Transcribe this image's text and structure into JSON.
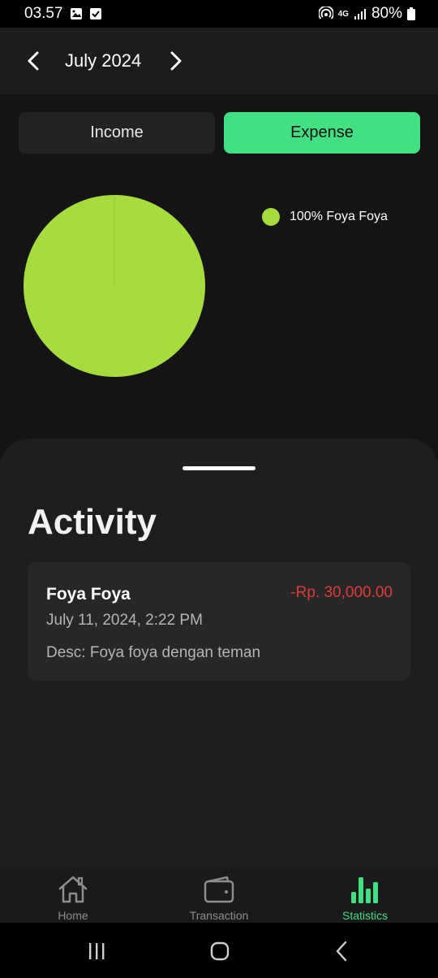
{
  "status_bar": {
    "time": "03.57",
    "network": "4G",
    "battery": "80%",
    "icons": [
      "gallery-icon",
      "checkbox-icon",
      "hotspot-icon",
      "signal-icon",
      "battery-icon"
    ]
  },
  "header": {
    "month": "July 2024",
    "prev_icon": "chevron-left-icon",
    "next_icon": "chevron-right-icon"
  },
  "toggle": {
    "income_label": "Income",
    "expense_label": "Expense",
    "selected": "Expense"
  },
  "chart_data": {
    "type": "pie",
    "slices": [
      {
        "label": "Foya Foya",
        "percent": 100,
        "color": "#a7dc3f"
      }
    ],
    "legend": [
      "100% Foya Foya"
    ],
    "legend_position": "right"
  },
  "activity": {
    "title": "Activity",
    "items": [
      {
        "name": "Foya Foya",
        "amount": "-Rp. 30,000.00",
        "date": "July 11, 2024, 2:22 PM",
        "desc": "Desc: Foya foya dengan teman"
      }
    ]
  },
  "bottom_nav": {
    "items": [
      {
        "label": "Home",
        "icon": "home-icon",
        "active": false
      },
      {
        "label": "Transaction",
        "icon": "wallet-icon",
        "active": false
      },
      {
        "label": "Statistics",
        "icon": "bar-chart-icon",
        "active": true
      }
    ]
  },
  "colors": {
    "accent": "#43df83",
    "expense_red": "#e23a3a",
    "pie_green": "#a7dc3f",
    "background": "#141414"
  }
}
